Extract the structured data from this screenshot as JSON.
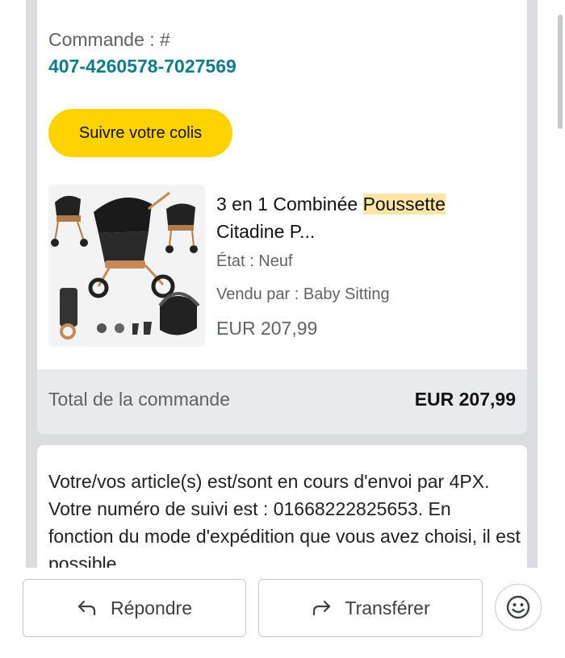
{
  "order": {
    "label": "Commande : #",
    "number": "407-4260578-7027569",
    "track_button": "Suivre votre colis"
  },
  "product": {
    "title_prefix": "3 en 1 Combinée ",
    "title_highlight": "Poussette",
    "title_suffix": " Citadine P...",
    "state": "État : Neuf",
    "seller": "Vendu par : Baby Sitting",
    "price": "EUR 207,99",
    "image_icon": "stroller-product-image"
  },
  "total": {
    "label": "Total de la commande",
    "value": "EUR 207,99"
  },
  "message": {
    "text": "Votre/vos article(s) est/sont en cours d'envoi par 4PX. Votre numéro de suivi est : 01668222825653. En fonction du mode d'expédition que vous avez choisi, il est possible"
  },
  "actions": {
    "reply_label": "Répondre",
    "forward_label": "Transférer",
    "reply_icon": "reply-arrow-icon",
    "forward_icon": "forward-arrow-icon",
    "emoji_icon": "emoji-icon"
  },
  "colors": {
    "accent_yellow": "#fcd200",
    "order_number": "#0f7c8c",
    "highlight": "#fde5a6"
  }
}
